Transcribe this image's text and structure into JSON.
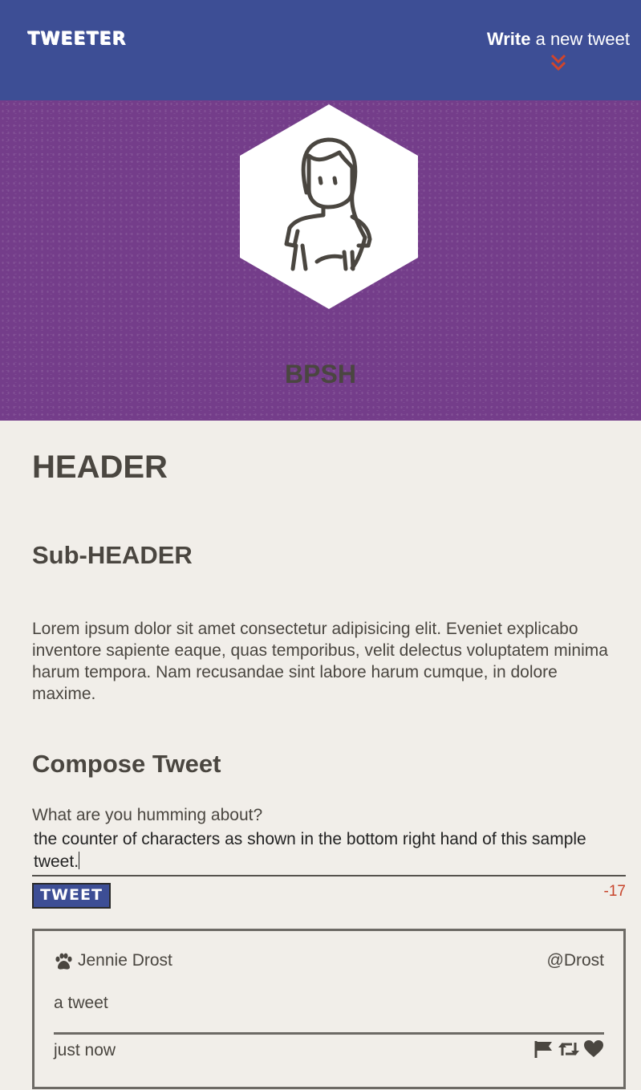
{
  "nav": {
    "brand": "TWEETER",
    "write_bold": "Write",
    "write_rest": " a new tweet",
    "chevron_icon": "double-chevron-down",
    "background_color": "#3d4e95",
    "chevron_color": "#d2452a"
  },
  "profile": {
    "handle": "BPSH",
    "avatar_icon": "person-avatar",
    "banner_color": "#743d8a"
  },
  "content": {
    "header": "HEADER",
    "subheader": "Sub-HEADER",
    "paragraph": "Lorem ipsum dolor sit amet consectetur adipisicing elit. Eveniet explicabo inventore sapiente eaque, quas temporibus, velit delectus voluptatem minima harum tempora. Nam recusandae sint labore harum cumque, in dolore maxime."
  },
  "compose": {
    "title": "Compose Tweet",
    "placeholder": "What are you humming about?",
    "value": "the counter of characters as shown in the bottom right hand of this sample tweet.",
    "button_label": "TWEET",
    "counter": "-17",
    "counter_color": "#c8452c"
  },
  "tweets": [
    {
      "name": "Jennie Drost",
      "handle": "@Drost",
      "text": "a tweet",
      "time": "just now",
      "icons": [
        "paw-icon",
        "flag-icon",
        "retweet-icon",
        "heart-icon"
      ]
    }
  ]
}
